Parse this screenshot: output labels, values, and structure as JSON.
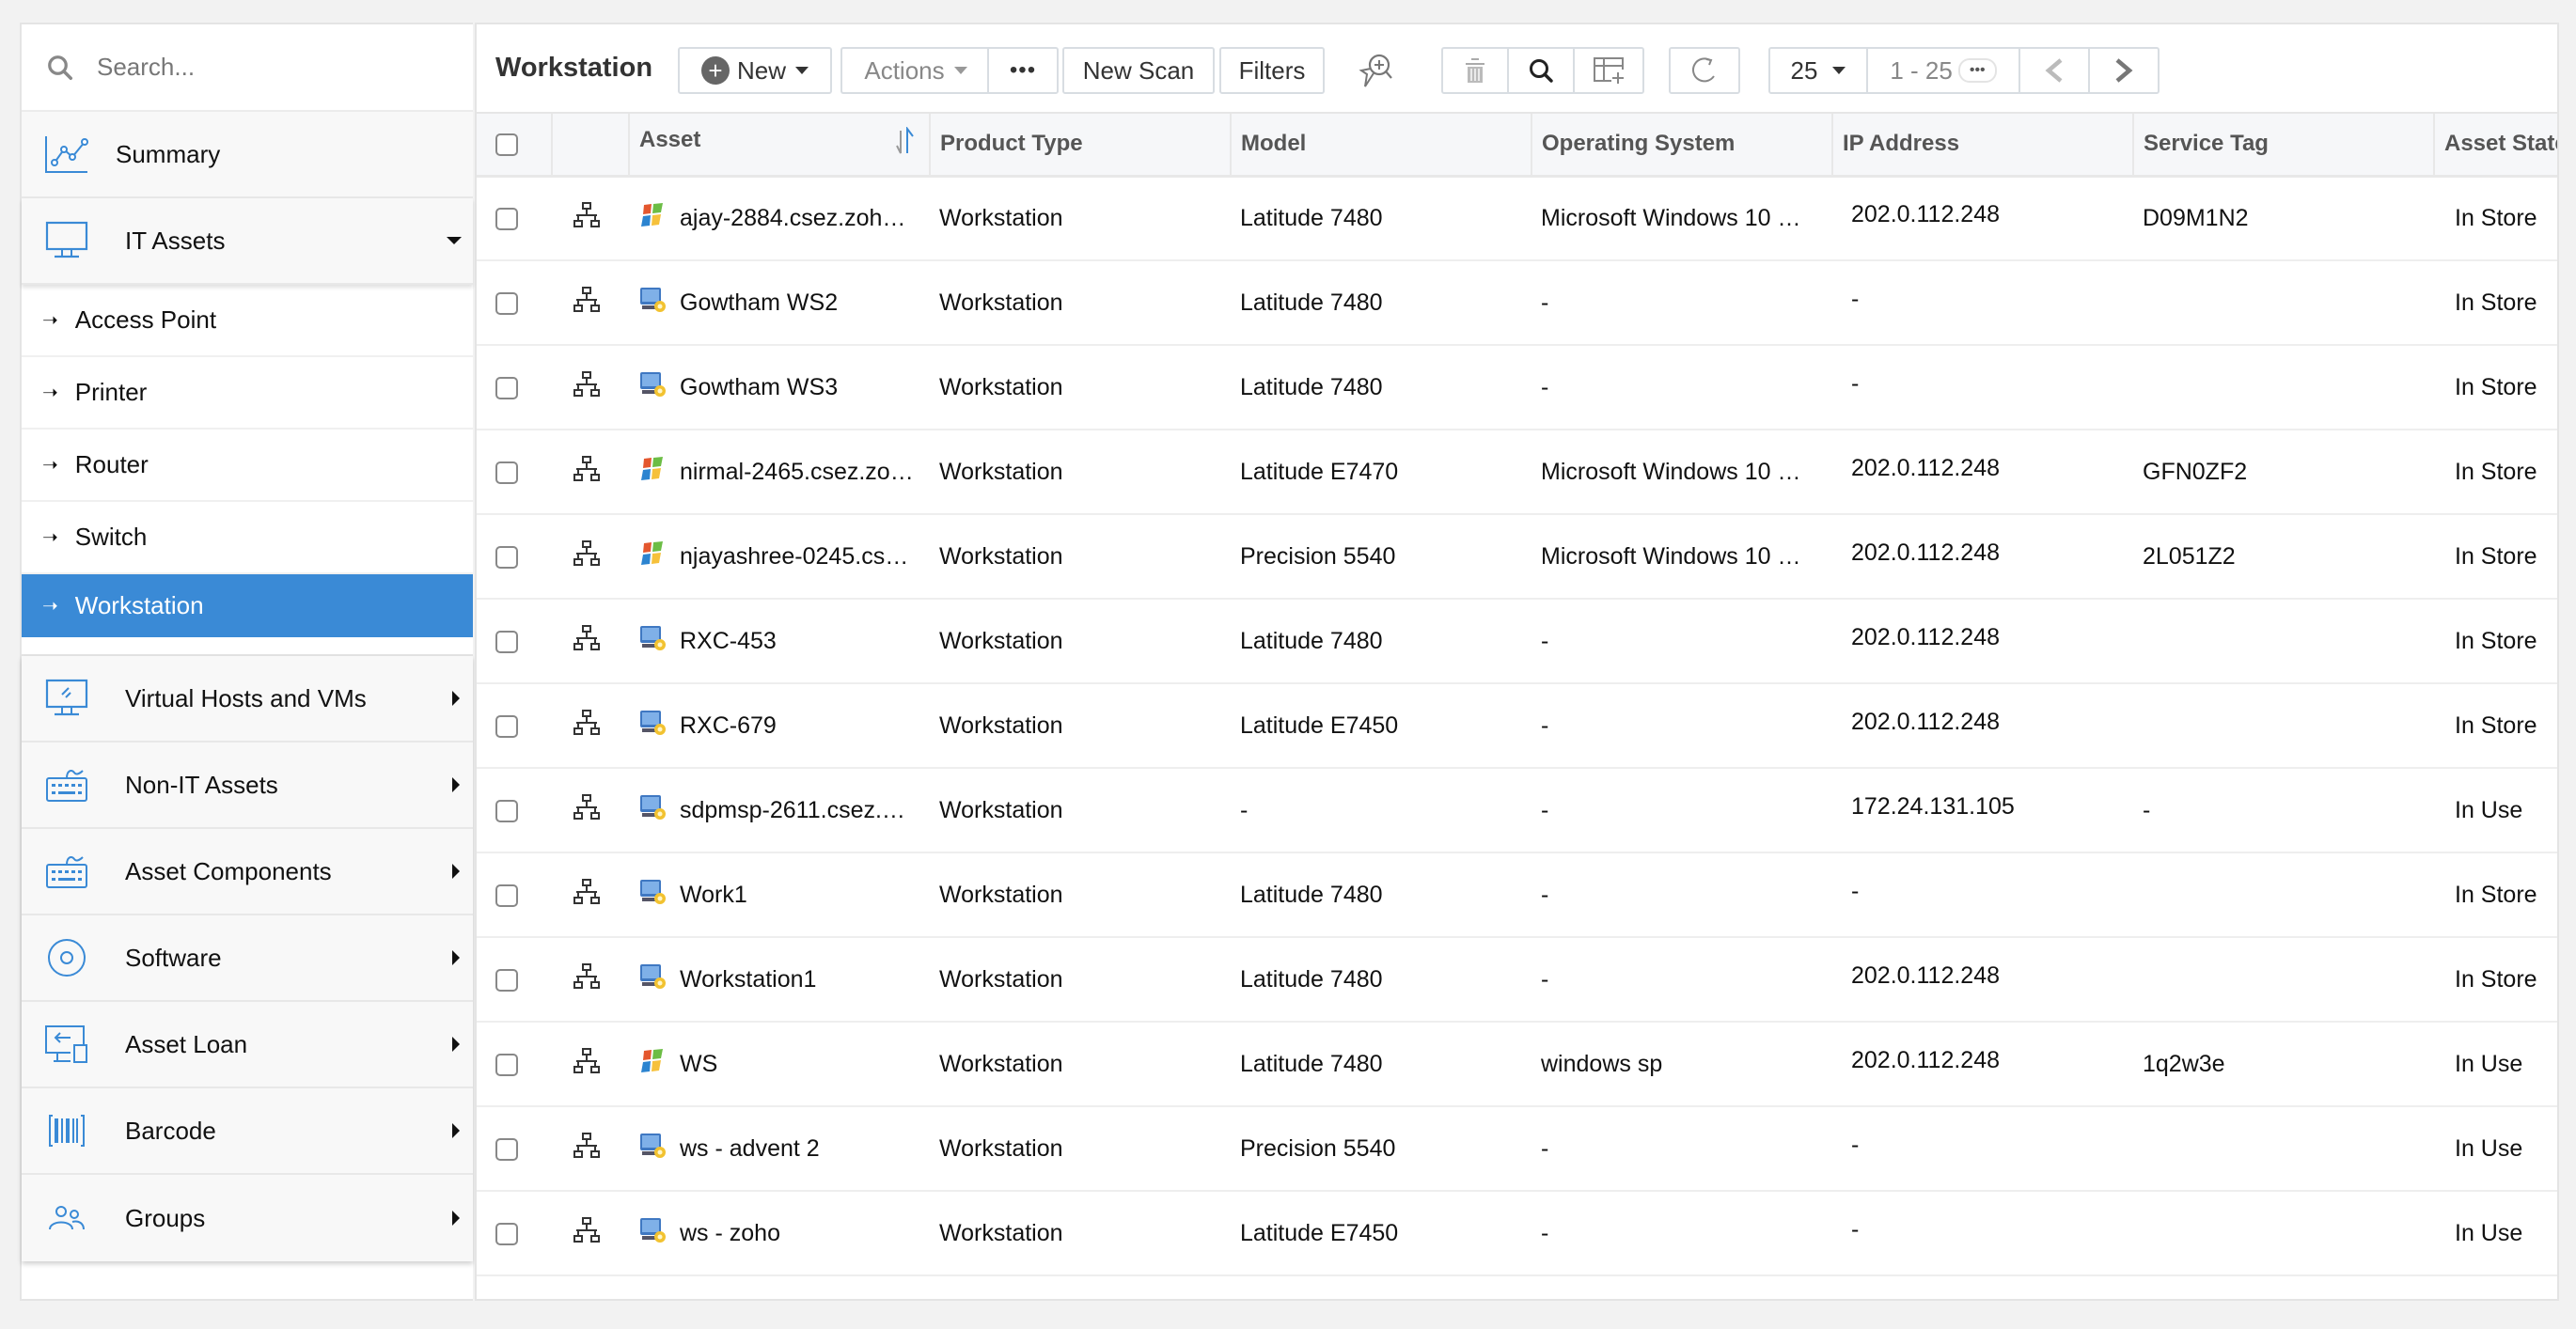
{
  "sidebar": {
    "search_placeholder": "Search...",
    "summary": {
      "label": "Summary",
      "icon": "chart-line-icon"
    },
    "it_assets": {
      "label": "IT Assets",
      "icon": "monitor-icon",
      "expanded": true,
      "items": [
        {
          "label": "Access Point",
          "active": false
        },
        {
          "label": "Printer",
          "active": false
        },
        {
          "label": "Router",
          "active": false
        },
        {
          "label": "Switch",
          "active": false
        },
        {
          "label": "Workstation",
          "active": true
        }
      ]
    },
    "categories": [
      {
        "label": "Virtual Hosts and VMs",
        "icon": "virtual-monitor-icon"
      },
      {
        "label": "Non-IT Assets",
        "icon": "keyboard-icon"
      },
      {
        "label": "Asset Components",
        "icon": "keyboard-icon"
      },
      {
        "label": "Software",
        "icon": "disc-icon"
      },
      {
        "label": "Asset Loan",
        "icon": "devices-icon"
      },
      {
        "label": "Barcode",
        "icon": "barcode-icon"
      },
      {
        "label": "Groups",
        "icon": "users-icon"
      }
    ],
    "sub_arrow": "➝",
    "accent_color": "#3a8ad6"
  },
  "toolbar": {
    "title": "Workstation",
    "new_label": "New",
    "new_icon": "+",
    "actions_label": "Actions",
    "more_label": "•••",
    "new_scan_label": "New Scan",
    "filters_label": "Filters",
    "page_size": "25",
    "range": "1 - 25",
    "range_more": "•••"
  },
  "table": {
    "columns": [
      "Asset",
      "Product Type",
      "Model",
      "Operating System",
      "IP Address",
      "Service Tag",
      "Asset State"
    ],
    "rows": [
      {
        "icon": "windows",
        "asset": "ajay-2884.csez.zoh…",
        "product_type": "Workstation",
        "model": "Latitude 7480",
        "os": "Microsoft Windows 10 …",
        "ip": "202.0.112.248",
        "service_tag": "D09M1N2",
        "state": "In Store"
      },
      {
        "icon": "workstation",
        "asset": "Gowtham WS2",
        "product_type": "Workstation",
        "model": "Latitude 7480",
        "os": "-",
        "ip": "-",
        "service_tag": "",
        "state": "In Store"
      },
      {
        "icon": "workstation",
        "asset": "Gowtham WS3",
        "product_type": "Workstation",
        "model": "Latitude 7480",
        "os": "-",
        "ip": "-",
        "service_tag": "",
        "state": "In Store"
      },
      {
        "icon": "windows",
        "asset": "nirmal-2465.csez.zo…",
        "product_type": "Workstation",
        "model": "Latitude E7470",
        "os": "Microsoft Windows 10 …",
        "ip": "202.0.112.248",
        "service_tag": "GFN0ZF2",
        "state": "In Store"
      },
      {
        "icon": "windows",
        "asset": "njayashree-0245.cs…",
        "product_type": "Workstation",
        "model": "Precision 5540",
        "os": "Microsoft Windows 10 …",
        "ip": "202.0.112.248",
        "service_tag": "2L051Z2",
        "state": "In Store"
      },
      {
        "icon": "workstation",
        "asset": "RXC-453",
        "product_type": "Workstation",
        "model": "Latitude 7480",
        "os": "-",
        "ip": "202.0.112.248",
        "service_tag": "",
        "state": "In Store"
      },
      {
        "icon": "workstation",
        "asset": "RXC-679",
        "product_type": "Workstation",
        "model": "Latitude E7450",
        "os": "-",
        "ip": "202.0.112.248",
        "service_tag": "",
        "state": "In Store"
      },
      {
        "icon": "workstation",
        "asset": "sdpmsp-2611.csez.…",
        "product_type": "Workstation",
        "model": "-",
        "os": "-",
        "ip": "172.24.131.105",
        "service_tag": "-",
        "state": "In Use"
      },
      {
        "icon": "workstation",
        "asset": "Work1",
        "product_type": "Workstation",
        "model": "Latitude 7480",
        "os": "-",
        "ip": "-",
        "service_tag": "",
        "state": "In Store"
      },
      {
        "icon": "workstation",
        "asset": "Workstation1",
        "product_type": "Workstation",
        "model": "Latitude 7480",
        "os": "-",
        "ip": "202.0.112.248",
        "service_tag": "",
        "state": "In Store"
      },
      {
        "icon": "windows",
        "asset": "WS",
        "product_type": "Workstation",
        "model": "Latitude 7480",
        "os": "windows sp",
        "ip": "202.0.112.248",
        "service_tag": "1q2w3e",
        "state": "In Use"
      },
      {
        "icon": "workstation",
        "asset": "ws - advent 2",
        "product_type": "Workstation",
        "model": "Precision 5540",
        "os": "-",
        "ip": "-",
        "service_tag": "",
        "state": "In Use"
      },
      {
        "icon": "workstation",
        "asset": "ws - zoho",
        "product_type": "Workstation",
        "model": "Latitude E7450",
        "os": "-",
        "ip": "-",
        "service_tag": "",
        "state": "In Use"
      }
    ]
  }
}
